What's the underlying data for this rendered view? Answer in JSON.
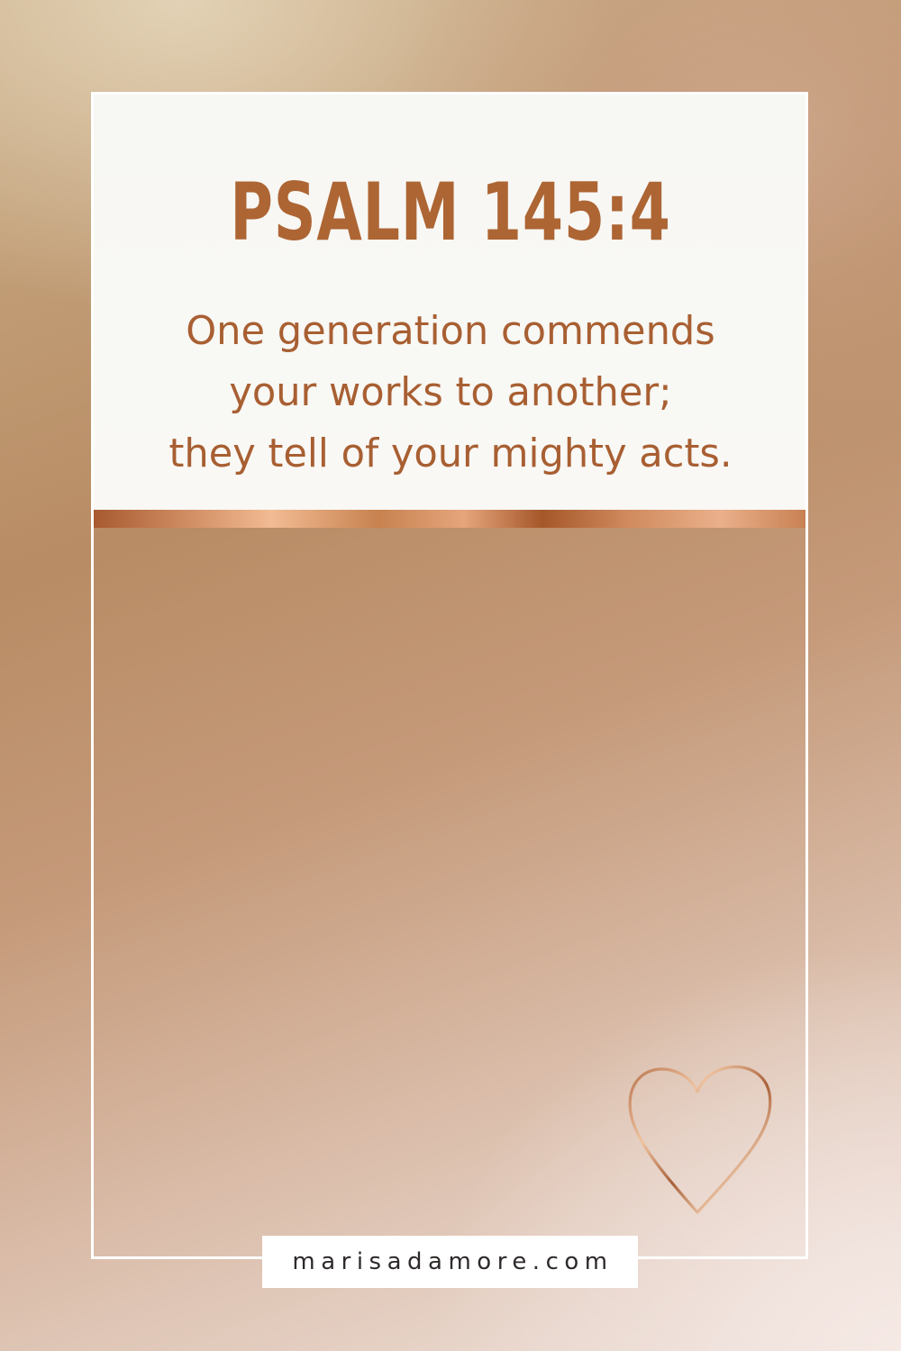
{
  "title": "PSALM 145:4",
  "verse": {
    "lines": [
      "One generation commends",
      "your works to another;",
      "they tell of your mighty acts."
    ]
  },
  "footer": {
    "website": "marisadamore.com"
  },
  "colors": {
    "title": "#ad6534",
    "verse": "#a85f32",
    "frame": "#ffffff",
    "panel": "#f8f7f4"
  },
  "decoration": {
    "icon": "heart-outline-icon"
  }
}
